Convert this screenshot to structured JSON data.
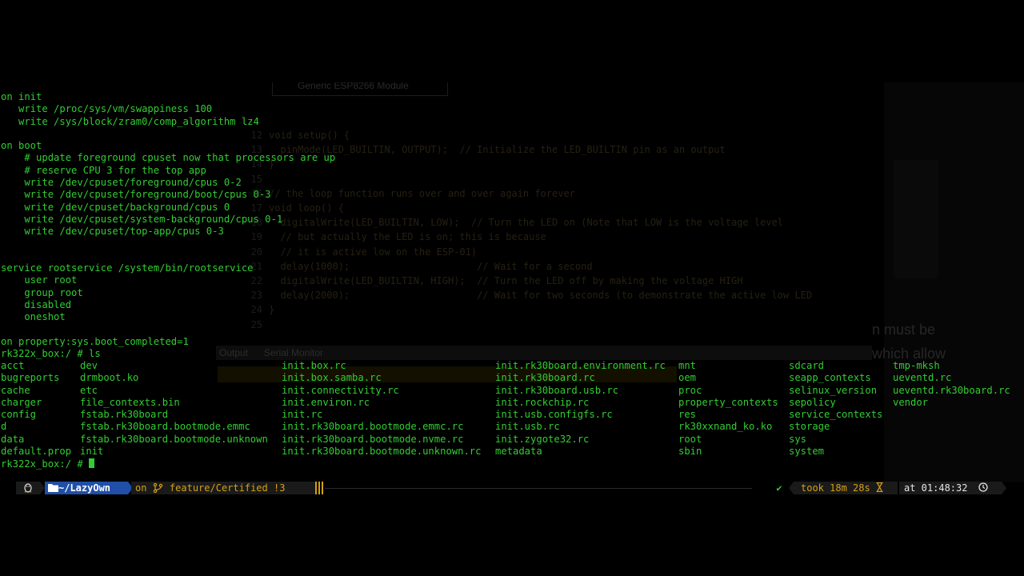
{
  "terminal": {
    "lines": [
      "on init",
      "   write /proc/sys/vm/swappiness 100",
      "   write /sys/block/zram0/comp_algorithm lz4",
      "",
      "on boot",
      "    # update foreground cpuset now that processors are up",
      "    # reserve CPU 3 for the top app",
      "    write /dev/cpuset/foreground/cpus 0-2",
      "    write /dev/cpuset/foreground/boot/cpus 0-3",
      "    write /dev/cpuset/background/cpus 0",
      "    write /dev/cpuset/system-background/cpus 0-1",
      "    write /dev/cpuset/top-app/cpus 0-3",
      "",
      "",
      "service rootservice /system/bin/rootservice",
      "    user root",
      "    group root",
      "    disabled",
      "    oneshot",
      "",
      "on property:sys.boot_completed=1",
      "rk322x_box:/ # ls"
    ],
    "ls_columns": [
      [
        "acct",
        "bugreports",
        "cache",
        "charger",
        "config",
        "d",
        "data",
        "default.prop"
      ],
      [
        "dev",
        "drmboot.ko",
        "etc",
        "file_contexts.bin",
        "fstab.rk30board",
        "fstab.rk30board.bootmode.emmc",
        "fstab.rk30board.bootmode.unknown",
        "init"
      ],
      [
        "init.box.rc",
        "init.box.samba.rc",
        "init.connectivity.rc",
        "init.environ.rc",
        "init.rc",
        "init.rk30board.bootmode.emmc.rc",
        "init.rk30board.bootmode.nvme.rc",
        "init.rk30board.bootmode.unknown.rc"
      ],
      [
        "init.rk30board.environment.rc",
        "init.rk30board.rc",
        "init.rk30board.usb.rc",
        "init.rockchip.rc",
        "init.usb.configfs.rc",
        "init.usb.rc",
        "init.zygote32.rc",
        "metadata"
      ],
      [
        "mnt",
        "oem",
        "proc",
        "property_contexts",
        "res",
        "rk30xxnand_ko.ko",
        "root",
        "sbin"
      ],
      [
        "sdcard",
        "seapp_contexts",
        "selinux_version",
        "sepolicy",
        "service_contexts",
        "storage",
        "sys",
        "system"
      ],
      [
        "tmp-mksh",
        "ueventd.rc",
        "ueventd.rk30board.rc",
        "vendor"
      ]
    ],
    "prompt": "rk322x_box:/ # ",
    "colors": {
      "text": "#32cd32",
      "background": "#000000"
    }
  },
  "statusbar": {
    "os_icon": "linux-penguin-icon",
    "dir_icon": "folder-icon",
    "directory": "~/LazyOwn",
    "git_prefix": "on",
    "git_icon": "git-branch-icon",
    "branch": "feature/Certified !3",
    "check": "✔",
    "took": "took 18m 28s",
    "hourglass_icon": "hourglass-icon",
    "at_time": "at 01:48:32",
    "clock_icon": "clock-icon",
    "colors": {
      "dir_bg": "#1f4fa8",
      "git_fg": "#d4a017",
      "seg_bg": "#1a1a1a"
    }
  },
  "ghost_ide": {
    "board": "Generic ESP8266 Module",
    "code_lines": [
      [
        "12",
        "void setup() {"
      ],
      [
        "13",
        "  pinMode(LED_BUILTIN, OUTPUT);  // Initialize the LED_BUILTIN pin as an output"
      ],
      [
        "14",
        "}"
      ],
      [
        "15",
        ""
      ],
      [
        "16",
        "// the loop function runs over and over again forever"
      ],
      [
        "17",
        "void loop() {"
      ],
      [
        "18",
        "  digitalWrite(LED_BUILTIN, LOW);  // Turn the LED on (Note that LOW is the voltage level"
      ],
      [
        "19",
        "  // but actually the LED is on; this is because"
      ],
      [
        "20",
        "  // it is active low on the ESP-01)"
      ],
      [
        "21",
        "  delay(1000);                      // Wait for a second"
      ],
      [
        "22",
        "  digitalWrite(LED_BUILTIN, HIGH);  // Turn the LED off by making the voltage HIGH"
      ],
      [
        "23",
        "  delay(2000);                      // Wait for two seconds (to demonstrate the active low LED"
      ],
      [
        "24",
        "}"
      ],
      [
        "25",
        ""
      ]
    ],
    "tab_output": "Output",
    "tab_serial": "Serial Monitor",
    "side_text_1": "n must be",
    "side_text_2": "which allow"
  }
}
